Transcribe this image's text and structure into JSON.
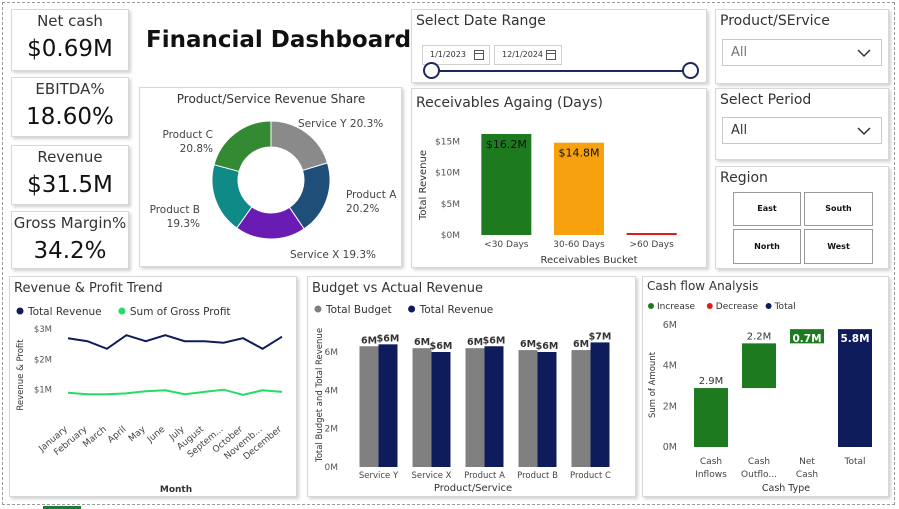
{
  "title": "Financial Dashboard",
  "kpis": [
    {
      "label": "Net cash",
      "value": "$0.69M"
    },
    {
      "label": "EBITDA%",
      "value": "18.60%"
    },
    {
      "label": "Revenue",
      "value": "$31.5M"
    },
    {
      "label": "Gross Margin%",
      "value": "34.2%"
    }
  ],
  "date_range": {
    "title": "Select Date Range",
    "start": "1/1/2023",
    "end": "12/1/2024"
  },
  "product_filter": {
    "title": "Product/SErvice",
    "value": "All"
  },
  "period_filter": {
    "title": "Select Period",
    "value": "All"
  },
  "region": {
    "title": "Region",
    "buttons": [
      "East",
      "South",
      "North",
      "West"
    ]
  },
  "colors": {
    "dark_navy": "#0f1c5c",
    "bright_green": "#22dd66",
    "grey": "#808080",
    "green": "#1e7a1e",
    "orange": "#f7a10e",
    "red": "#e01b1b",
    "pie_navy": "#1f4e79",
    "pie_teal": "#0f8a87",
    "pie_purple": "#6a1bb4",
    "pie_green": "#338a33",
    "pie_grey": "#8a8a8a"
  },
  "chart_data": [
    {
      "type": "pie",
      "title": "Product/Service Revenue Share",
      "labels": [
        "Service Y",
        "Product A",
        "Service X",
        "Product B",
        "Product C"
      ],
      "values": [
        20.3,
        20.2,
        19.3,
        19.3,
        20.8
      ],
      "value_labels": [
        "Service Y 20.3%",
        "Product A 20.2%",
        "Service X 19.3%",
        "Product B 19.3%",
        "Product C 20.8%"
      ],
      "colors": [
        "#8a8a8a",
        "#1f4e79",
        "#6a1bb4",
        "#0f8a87",
        "#338a33"
      ]
    },
    {
      "type": "bar",
      "title": "Receivables Againg (Days)",
      "categories": [
        "<30 Days",
        "30-60 Days",
        ">60 Days"
      ],
      "values": [
        16.2,
        14.8,
        0.4
      ],
      "data_labels": [
        "$16.2M",
        "$14.8M",
        ""
      ],
      "ylabel": "Total Revenue",
      "xlabel": "Receivables Bucket",
      "ylim": [
        0,
        17
      ],
      "yticks": [
        0,
        5,
        10,
        15
      ],
      "ytick_labels": [
        "$0M",
        "$5M",
        "$10M",
        "$15M"
      ],
      "colors": [
        "#1e7a1e",
        "#f7a10e",
        "#e01b1b"
      ]
    },
    {
      "type": "line",
      "title": "Revenue & Profit Trend",
      "categories": [
        "January",
        "February",
        "March",
        "April",
        "May",
        "June",
        "July",
        "August",
        "Septem...",
        "October",
        "Novemb...",
        "December"
      ],
      "series": [
        {
          "name": "Total Revenue",
          "values": [
            2.7,
            2.6,
            2.35,
            2.8,
            2.6,
            2.8,
            2.6,
            2.6,
            2.55,
            2.7,
            2.35,
            2.75
          ]
        },
        {
          "name": "Sum of Gross Profit",
          "values": [
            0.9,
            0.85,
            0.85,
            0.88,
            0.95,
            0.98,
            0.85,
            0.93,
            1.0,
            0.83,
            0.98,
            0.93
          ]
        }
      ],
      "xlabel": "Month",
      "ylabel": "Revenue & Profit",
      "ylim": [
        0,
        3.4
      ],
      "yticks": [
        1,
        2,
        3
      ],
      "ytick_labels": [
        "$1M",
        "$2M",
        "$3M"
      ],
      "colors": [
        "#0f1c5c",
        "#22dd66"
      ]
    },
    {
      "type": "bar",
      "title": "Budget vs Actual Revenue",
      "categories": [
        "Service Y",
        "Service X",
        "Product A",
        "Product B",
        "Product C"
      ],
      "series": [
        {
          "name": "Total Budget",
          "values": [
            6.3,
            6.2,
            6.2,
            6.1,
            6.1
          ],
          "labels": [
            "6M",
            "6M",
            "6M",
            "6M",
            "6M"
          ]
        },
        {
          "name": "Total Revenue",
          "values": [
            6.4,
            6.0,
            6.3,
            6.0,
            6.5
          ],
          "labels": [
            "$6M",
            "$6M",
            "$6M",
            "$6M",
            "$7M"
          ]
        }
      ],
      "xlabel": "Product/Service",
      "ylabel": "Total Budget and Total Revenue",
      "ylim": [
        0,
        7.2
      ],
      "yticks": [
        0,
        2,
        4,
        6
      ],
      "ytick_labels": [
        "0M",
        "2M",
        "4M",
        "6M"
      ],
      "colors": [
        "#808080",
        "#0f1c5c"
      ]
    },
    {
      "type": "bar",
      "title": "Cash flow Analysis",
      "subtype": "waterfall",
      "legend": [
        "Increase",
        "Decrease",
        "Total"
      ],
      "legend_colors": [
        "#1e7a1e",
        "#e01b1b",
        "#0f1c5c"
      ],
      "categories": [
        "Cash Inflows",
        "Cash Outflo...",
        "Net Cash",
        "Total"
      ],
      "category_lines": [
        [
          "Cash",
          "Inflows"
        ],
        [
          "Cash",
          "Outflo..."
        ],
        [
          "Net",
          "Cash"
        ],
        [
          "Total"
        ]
      ],
      "values": [
        2.9,
        2.2,
        0.7,
        5.8
      ],
      "kinds": [
        "increase",
        "increase",
        "increase",
        "total"
      ],
      "data_labels": [
        "2.9M",
        "2.2M",
        "0.7M",
        "5.8M"
      ],
      "xlabel": "Cash Type",
      "ylabel": "Sum of Amount",
      "ylim": [
        0,
        6.2
      ],
      "yticks": [
        0,
        2,
        4,
        6
      ],
      "ytick_labels": [
        "0M",
        "2M",
        "4M",
        "6M"
      ]
    }
  ]
}
